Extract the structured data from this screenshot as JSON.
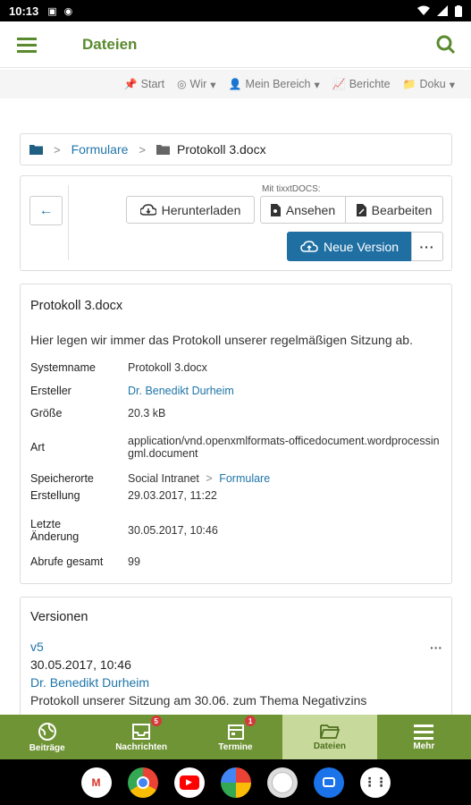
{
  "status": {
    "time": "10:13"
  },
  "appbar": {
    "title": "Dateien"
  },
  "topnav": {
    "items": [
      {
        "label": "Start",
        "icon": "pin-icon"
      },
      {
        "label": "Wir",
        "icon": "group-icon",
        "dropdown": true
      },
      {
        "label": "Mein Bereich",
        "icon": "user-icon",
        "dropdown": true
      },
      {
        "label": "Berichte",
        "icon": "chart-icon"
      },
      {
        "label": "Doku",
        "icon": "folder-icon",
        "dropdown": true
      }
    ]
  },
  "breadcrumb": {
    "folder": "Formulare",
    "file": "Protokoll 3.docx"
  },
  "actions": {
    "mit_label": "Mit tixxtDOCS:",
    "download": "Herunterladen",
    "view": "Ansehen",
    "edit": "Bearbeiten",
    "new_version": "Neue Version",
    "more": "···"
  },
  "details": {
    "title": "Protokoll 3.docx",
    "description": "Hier legen wir immer das Protokoll unserer regelmäßigen Sitzung ab.",
    "fields": {
      "systemname_k": "Systemname",
      "systemname_v": "Protokoll 3.docx",
      "ersteller_k": "Ersteller",
      "ersteller_v": "Dr. Benedikt Durheim",
      "groesse_k": "Größe",
      "groesse_v": "20.3 kB",
      "art_k": "Art",
      "art_v": "application/vnd.openxmlformats-officedocument.wordprocessingml.document",
      "speicherorte_k": "Speicherorte",
      "speicherorte_v1": "Social Intranet",
      "speicherorte_v2": "Formulare",
      "erstellung_k": "Erstellung",
      "erstellung_v": "29.03.2017, 11:22",
      "letzte_k1": "Letzte",
      "letzte_k2": "Änderung",
      "letzte_v": "30.05.2017, 10:46",
      "abrufe_k": "Abrufe gesamt",
      "abrufe_v": "99"
    }
  },
  "versions": {
    "title": "Versionen",
    "items": [
      {
        "label": "v5",
        "date": "30.05.2017, 10:46",
        "author": "Dr. Benedikt Durheim",
        "comment": "Protokoll unserer Sitzung am 30.06. zum Thema Negativzins"
      }
    ]
  },
  "bottomnav": {
    "items": [
      {
        "label": "Beiträge"
      },
      {
        "label": "Nachrichten",
        "badge": "5"
      },
      {
        "label": "Termine",
        "badge": "1"
      },
      {
        "label": "Dateien"
      },
      {
        "label": "Mehr"
      }
    ]
  },
  "colors": {
    "brand_green": "#6f9435",
    "link_blue": "#1f75a8",
    "primary_button": "#1f6fa3",
    "badge_red": "#d43a3a"
  }
}
